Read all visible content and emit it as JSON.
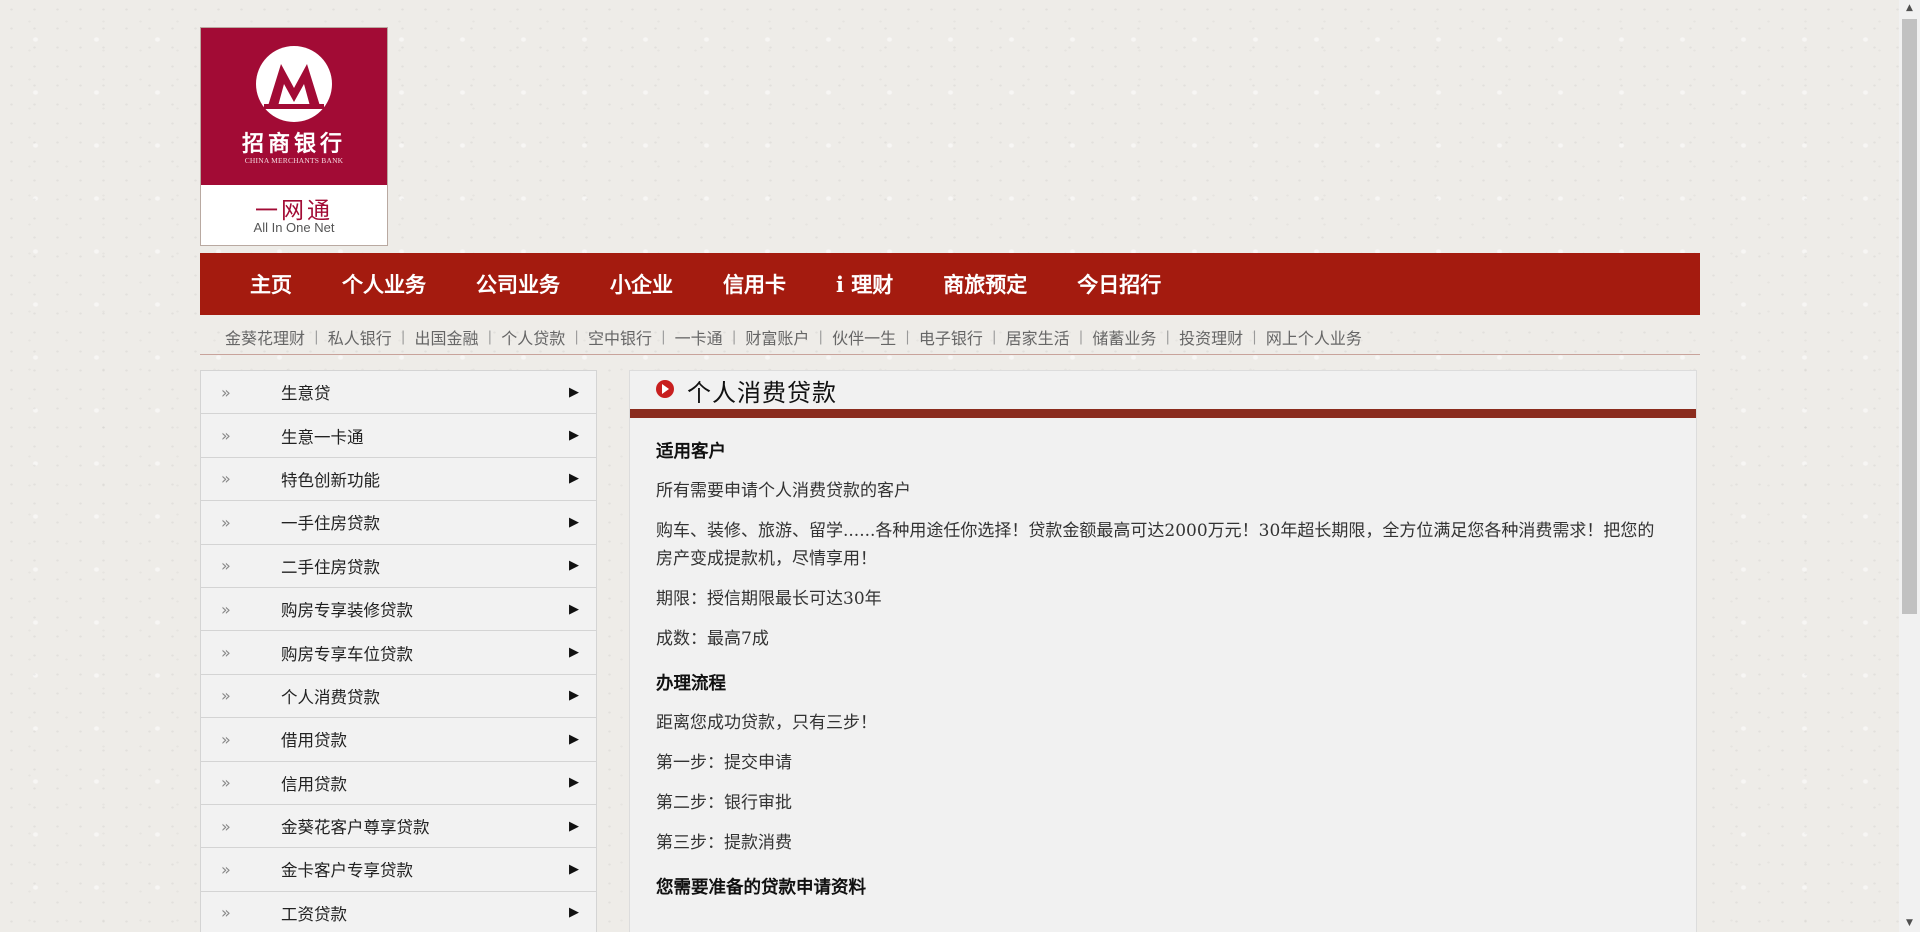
{
  "logo": {
    "name_cn": "招商银行",
    "name_en": "CHINA MERCHANTS BANK",
    "sub_cn": "一网通",
    "sub_en": "All In One Net",
    "brand_color": "#a20b35"
  },
  "main_nav": {
    "items": [
      {
        "label": "主页"
      },
      {
        "label": "个人业务"
      },
      {
        "label": "公司业务"
      },
      {
        "label": "小企业"
      },
      {
        "label": "信用卡"
      },
      {
        "label": "i 理财"
      },
      {
        "label": "商旅预定"
      },
      {
        "label": "今日招行"
      }
    ],
    "bg_color": "#a41b0f"
  },
  "sub_nav": {
    "items": [
      {
        "label": "金葵花理财"
      },
      {
        "label": "私人银行"
      },
      {
        "label": "出国金融"
      },
      {
        "label": "个人贷款"
      },
      {
        "label": "空中银行"
      },
      {
        "label": "一卡通"
      },
      {
        "label": "财富账户"
      },
      {
        "label": "伙伴一生"
      },
      {
        "label": "电子银行"
      },
      {
        "label": "居家生活"
      },
      {
        "label": "储蓄业务"
      },
      {
        "label": "投资理财"
      },
      {
        "label": "网上个人业务"
      }
    ]
  },
  "sidebar": {
    "items": [
      {
        "label": "生意贷"
      },
      {
        "label": "生意一卡通"
      },
      {
        "label": "特色创新功能"
      },
      {
        "label": "一手住房贷款"
      },
      {
        "label": "二手住房贷款"
      },
      {
        "label": "购房专享装修贷款"
      },
      {
        "label": "购房专享车位贷款"
      },
      {
        "label": "个人消费贷款"
      },
      {
        "label": "借用贷款"
      },
      {
        "label": "信用贷款"
      },
      {
        "label": "金葵花客户尊享贷款"
      },
      {
        "label": "金卡客户专享贷款"
      },
      {
        "label": "工资贷款"
      }
    ],
    "bullet_icon": "double-right-chevron",
    "arrow_icon": "right-triangle"
  },
  "content": {
    "title": "个人消费贷款",
    "title_icon": "right-arrow-circle",
    "accent_color": "#8b2c1e",
    "sections": {
      "customers": {
        "heading": "适用客户",
        "p1": "所有需要申请个人消费贷款的客户",
        "p2": "购车、装修、旅游、留学......各种用途任你选择！贷款金额最高可达2000万元！30年超长期限，全方位满足您各种消费需求！把您的房产变成提款机，尽情享用！",
        "p3": "期限：授信期限最长可达30年",
        "p4": "成数：最高7成"
      },
      "process": {
        "heading": "办理流程",
        "p1": "距离您成功贷款，只有三步！",
        "p2": "第一步：提交申请",
        "p3": "第二步：银行审批",
        "p4": "第三步：提款消费"
      },
      "materials": {
        "heading": "您需要准备的贷款申请资料"
      }
    }
  }
}
